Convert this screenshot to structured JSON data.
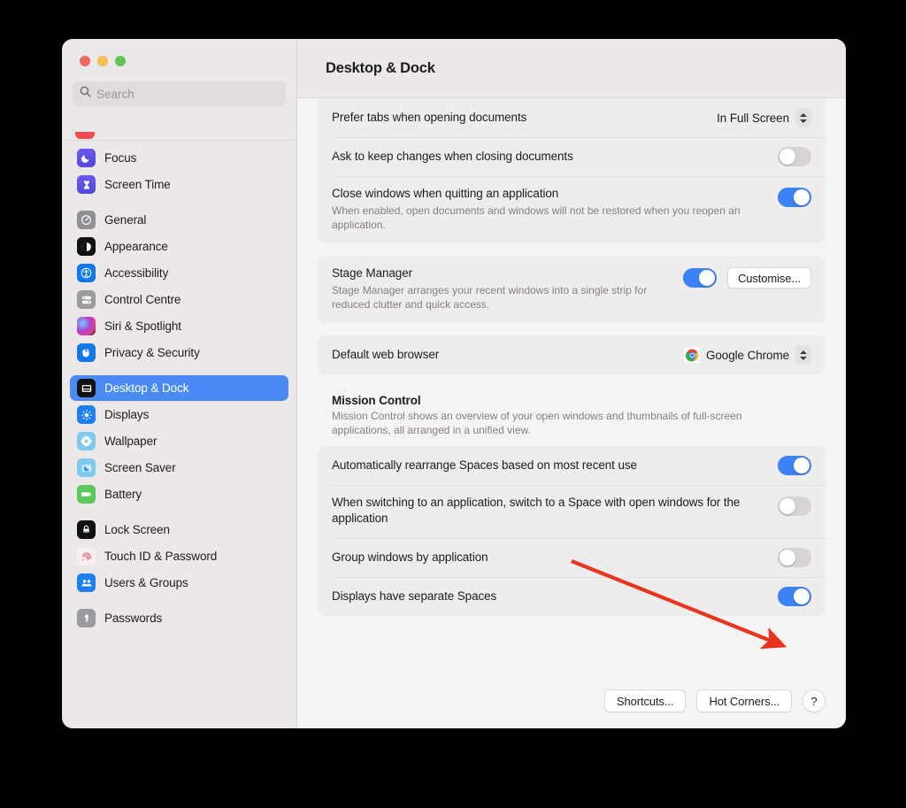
{
  "window": {
    "title": "Desktop & Dock",
    "traffic_lights": [
      "close",
      "minimise",
      "zoom"
    ]
  },
  "sidebar": {
    "search": {
      "value": "",
      "placeholder": "Search"
    },
    "groups": [
      {
        "items": [
          {
            "label": "Focus",
            "icon": "focus-icon",
            "selected": false
          },
          {
            "label": "Screen Time",
            "icon": "screen-time-icon",
            "selected": false
          }
        ]
      },
      {
        "items": [
          {
            "label": "General",
            "icon": "general-icon",
            "selected": false
          },
          {
            "label": "Appearance",
            "icon": "appearance-icon",
            "selected": false
          },
          {
            "label": "Accessibility",
            "icon": "accessibility-icon",
            "selected": false
          },
          {
            "label": "Control Centre",
            "icon": "control-centre-icon",
            "selected": false
          },
          {
            "label": "Siri & Spotlight",
            "icon": "siri-icon",
            "selected": false
          },
          {
            "label": "Privacy & Security",
            "icon": "privacy-icon",
            "selected": false
          }
        ]
      },
      {
        "items": [
          {
            "label": "Desktop & Dock",
            "icon": "desktop-dock-icon",
            "selected": true
          },
          {
            "label": "Displays",
            "icon": "displays-icon",
            "selected": false
          },
          {
            "label": "Wallpaper",
            "icon": "wallpaper-icon",
            "selected": false
          },
          {
            "label": "Screen Saver",
            "icon": "screen-saver-icon",
            "selected": false
          },
          {
            "label": "Battery",
            "icon": "battery-icon",
            "selected": false
          }
        ]
      },
      {
        "items": [
          {
            "label": "Lock Screen",
            "icon": "lock-screen-icon",
            "selected": false
          },
          {
            "label": "Touch ID & Password",
            "icon": "touch-id-icon",
            "selected": false
          },
          {
            "label": "Users & Groups",
            "icon": "users-groups-icon",
            "selected": false
          }
        ]
      },
      {
        "items": [
          {
            "label": "Passwords",
            "icon": "passwords-icon",
            "selected": false
          }
        ]
      }
    ]
  },
  "main": {
    "windows_card": {
      "prefer_tabs": {
        "label": "Prefer tabs when opening documents",
        "value": "In Full Screen"
      },
      "ask_keep_changes": {
        "label": "Ask to keep changes when closing documents",
        "toggle": "off"
      },
      "close_windows": {
        "label": "Close windows when quitting an application",
        "sub": "When enabled, open documents and windows will not be restored when you reopen an application.",
        "toggle": "on"
      }
    },
    "stage_manager": {
      "label": "Stage Manager",
      "sub": "Stage Manager arranges your recent windows into a single strip for reduced clutter and quick access.",
      "toggle": "on",
      "button": "Customise..."
    },
    "default_browser": {
      "label": "Default web browser",
      "value": "Google Chrome",
      "icon": "chrome-icon"
    },
    "mission_control": {
      "heading": "Mission Control",
      "sub": "Mission Control shows an overview of your open windows and thumbnails of full-screen applications, all arranged in a unified view.",
      "rows": [
        {
          "label": "Automatically rearrange Spaces based on most recent use",
          "toggle": "on"
        },
        {
          "label": "When switching to an application, switch to a Space with open windows for the application",
          "toggle": "off"
        },
        {
          "label": "Group windows by application",
          "toggle": "off"
        },
        {
          "label": "Displays have separate Spaces",
          "toggle": "on"
        }
      ]
    },
    "footer": {
      "shortcuts": "Shortcuts...",
      "hot_corners": "Hot Corners...",
      "help": "?"
    }
  },
  "annotation": {
    "arrow_color": "#e8341c",
    "points_at": "Displays have separate Spaces"
  },
  "colors": {
    "accent_blue": "#3b82f6",
    "selection_blue": "#4a8af4",
    "sidebar_bg": "#ece7e8",
    "content_bg": "#f5f3f3",
    "card_bg": "#eeecec",
    "arrow_red": "#e8341c"
  }
}
